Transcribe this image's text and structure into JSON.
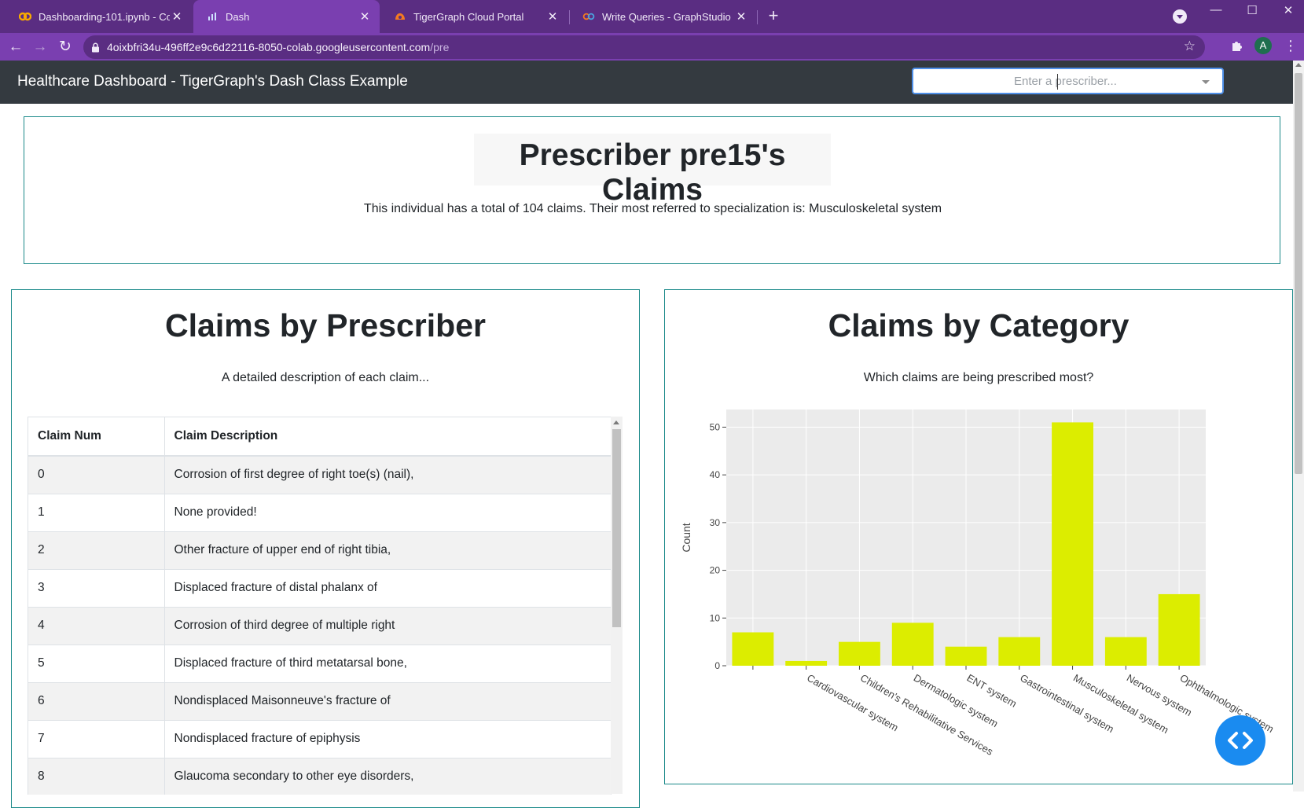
{
  "browser": {
    "tabs": [
      {
        "label": "Dashboarding-101.ipynb - Colab",
        "icon": "colab-icon",
        "active": false
      },
      {
        "label": "Dash",
        "icon": "dash-icon",
        "active": true
      },
      {
        "label": "TigerGraph Cloud Portal",
        "icon": "tigergraph-icon",
        "active": false
      },
      {
        "label": "Write Queries - GraphStudio",
        "icon": "graphstudio-icon",
        "active": false
      }
    ],
    "url_host": "4oixbfri34u-496ff2e9c6d22116-8050-colab.googleusercontent.com",
    "url_path": "/pre",
    "profile_initial": "A"
  },
  "app": {
    "title": "Healthcare Dashboard - TigerGraph's Dash Class Example",
    "prescriber_placeholder": "Enter a prescriber..."
  },
  "summary": {
    "title": "Prescriber pre15's Claims",
    "text": "This individual has a total of 104 claims. Their most referred to specialization is: Musculoskeletal system"
  },
  "claims_panel": {
    "title": "Claims by Prescriber",
    "subtitle": "A detailed description of each claim...",
    "columns": [
      "Claim Num",
      "Claim Description"
    ],
    "rows": [
      [
        "0",
        "Corrosion of first degree of right toe(s) (nail),"
      ],
      [
        "1",
        "None provided!"
      ],
      [
        "2",
        "Other fracture of upper end of right tibia,"
      ],
      [
        "3",
        "Displaced fracture of distal phalanx of"
      ],
      [
        "4",
        "Corrosion of third degree of multiple right"
      ],
      [
        "5",
        "Displaced fracture of third metatarsal bone,"
      ],
      [
        "6",
        "Nondisplaced Maisonneuve's fracture of"
      ],
      [
        "7",
        "Nondisplaced fracture of epiphysis"
      ],
      [
        "8",
        "Glaucoma secondary to other eye disorders,"
      ]
    ]
  },
  "category_panel": {
    "title": "Claims by Category",
    "subtitle": "Which claims are being prescribed most?"
  },
  "chart_data": {
    "type": "bar",
    "categories": [
      "",
      "Cardiovascular system",
      "Children's Rehabilitative Services",
      "Dermatologic system",
      "ENT system",
      "Gastrointestinal system",
      "Musculoskeletal system",
      "Nervous system",
      "Ophthalmologic system"
    ],
    "values": [
      7,
      1,
      5,
      9,
      4,
      6,
      51,
      6,
      15
    ],
    "xlabel": "",
    "ylabel": "Count",
    "ylim": [
      0,
      53.7
    ],
    "yticks": [
      0,
      10,
      20,
      30,
      40,
      50
    ],
    "grid": true,
    "bar_color": "#dced00",
    "plot_bg": "#ebebeb"
  }
}
